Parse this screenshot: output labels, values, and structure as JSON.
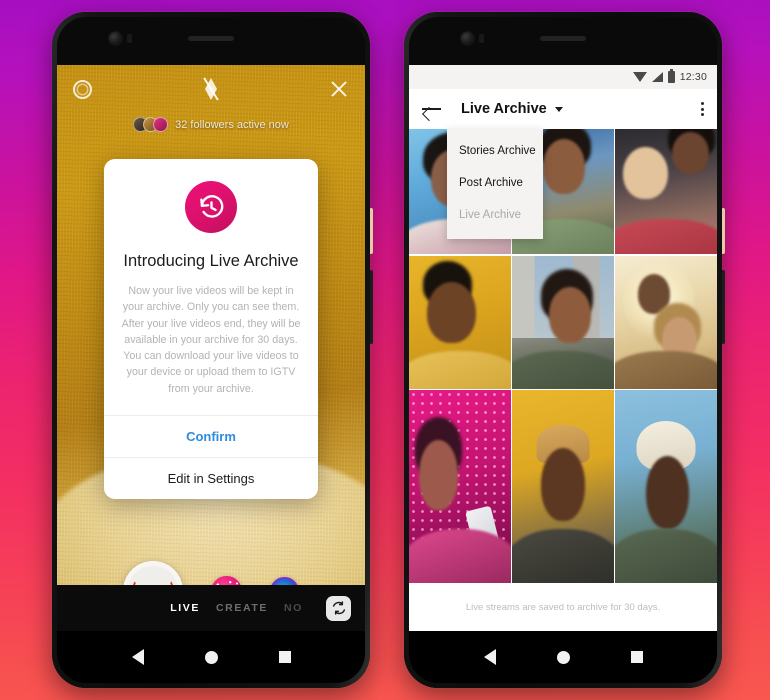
{
  "background": {
    "gradient_top": "#a50fc0",
    "gradient_mid": "#ec2370",
    "gradient_bottom": "#f9574f"
  },
  "phone_left": {
    "camera_screen": {
      "top_icons": {
        "settings": "gear-icon",
        "flash": "flash-off-icon",
        "close": "close-icon"
      },
      "followers_status": "32 followers active now",
      "controls": {
        "live_button": "live-broadcast-button",
        "effects_button": "effects-button",
        "filter_button": "filter-button"
      },
      "mode_tabs": [
        {
          "label": "LIVE",
          "state": "active"
        },
        {
          "label": "CREATE",
          "state": "inactive"
        },
        {
          "label": "NO",
          "state": "truncated"
        }
      ],
      "flip_camera": "flip-camera-icon"
    },
    "modal": {
      "icon": "history-restore-icon",
      "icon_color": "#e0116f",
      "title": "Introducing Live Archive",
      "body": "Now your live videos will be kept in your archive. Only you can see them. After your live videos end, they will be available in your archive for 30 days. You can download your live videos to your device or upload them to IGTV from your archive.",
      "primary_button": "Confirm",
      "primary_color": "#2e8ce0",
      "secondary_button": "Edit in Settings"
    }
  },
  "phone_right": {
    "status_bar": {
      "wifi": "wifi-icon",
      "signal": "signal-icon",
      "battery": "battery-icon",
      "time": "12:30"
    },
    "app_bar": {
      "back": "back-arrow-icon",
      "title": "Live Archive",
      "caret": "chevron-down-icon",
      "menu": "overflow-menu-icon"
    },
    "dropdown": [
      {
        "label": "Stories Archive",
        "selected": false
      },
      {
        "label": "Post Archive",
        "selected": false
      },
      {
        "label": "Live Archive",
        "selected": true
      }
    ],
    "grid": [
      {
        "id": 1,
        "desc": "person-blue-background"
      },
      {
        "id": 2,
        "desc": "person-green-shirt"
      },
      {
        "id": 3,
        "desc": "two-people-red"
      },
      {
        "id": 4,
        "desc": "person-yellow-wall"
      },
      {
        "id": 5,
        "desc": "person-city-street"
      },
      {
        "id": 6,
        "desc": "two-people-sunlight"
      },
      {
        "id": 7,
        "desc": "person-pink-led-wall"
      },
      {
        "id": 8,
        "desc": "person-yellow-brick"
      },
      {
        "id": 9,
        "desc": "person-bucket-hat"
      }
    ],
    "footer_note": "Live streams are saved to archive for 30 days."
  },
  "nav_bar": {
    "back": "nav-back-icon",
    "home": "nav-home-icon",
    "recents": "nav-recents-icon"
  }
}
